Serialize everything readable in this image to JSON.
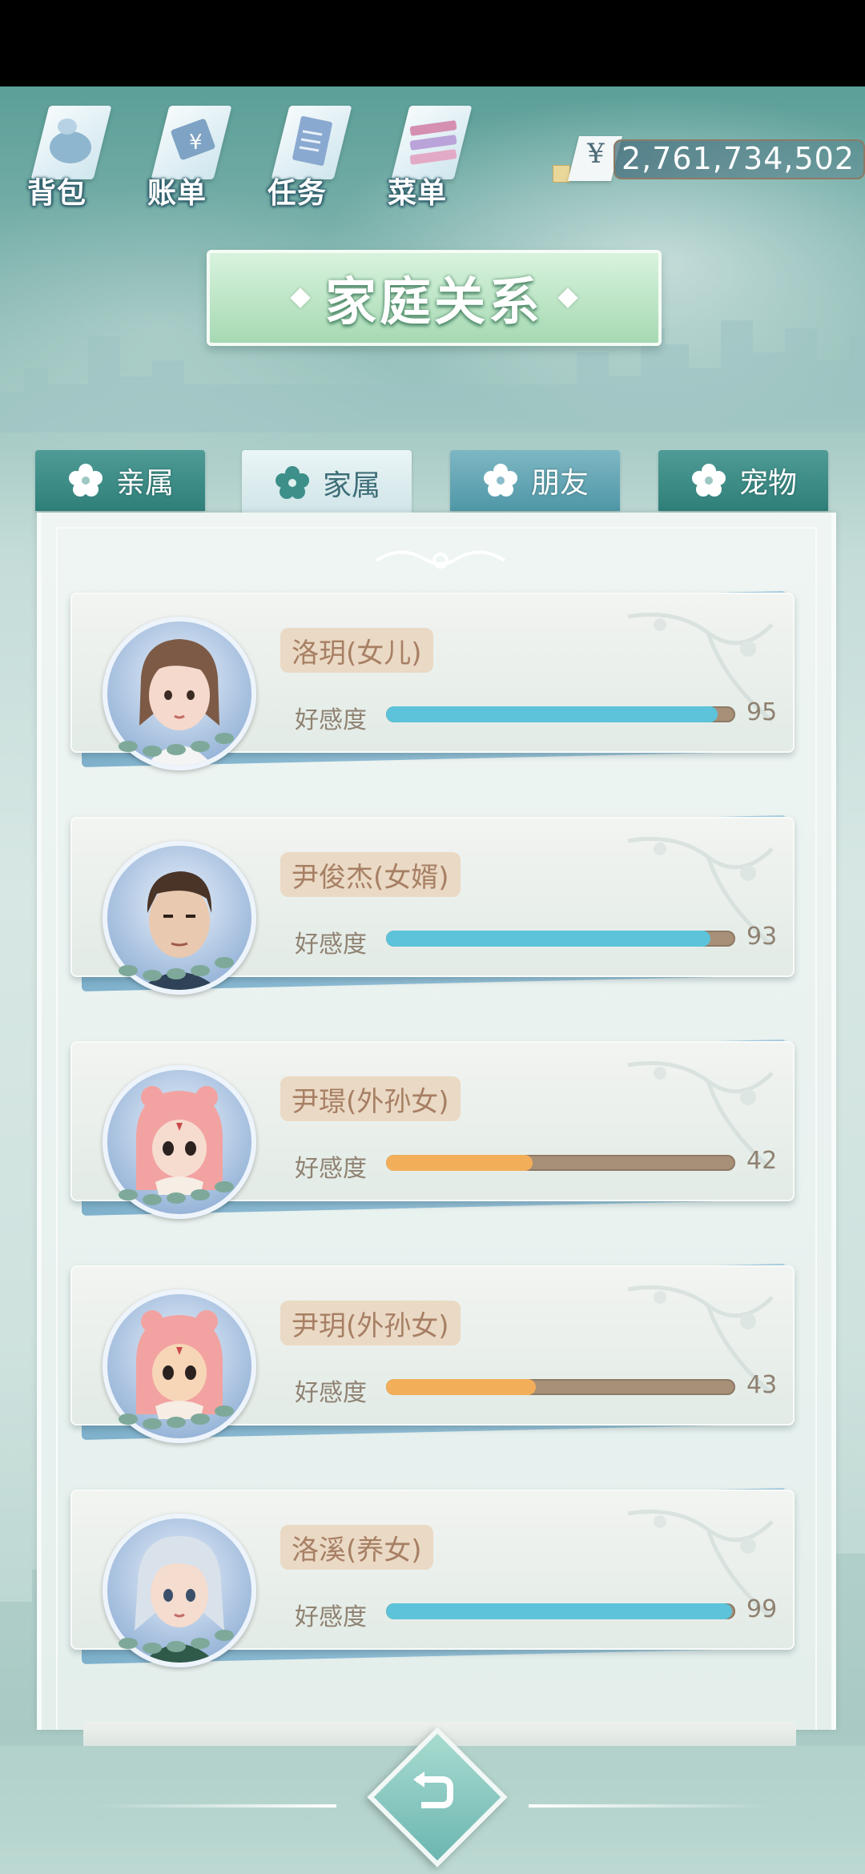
{
  "toolbar": {
    "items": [
      {
        "label": "背包",
        "icon": "backpack-icon"
      },
      {
        "label": "账单",
        "icon": "bill-icon"
      },
      {
        "label": "任务",
        "icon": "task-icon"
      },
      {
        "label": "菜单",
        "icon": "menu-icon"
      }
    ]
  },
  "currency": {
    "symbol": "¥",
    "amount": "2,761,734,502"
  },
  "title": "家庭关系",
  "tabs": [
    {
      "label": "亲属",
      "active": false
    },
    {
      "label": "家属",
      "active": true
    },
    {
      "label": "朋友",
      "active": false
    },
    {
      "label": "宠物",
      "active": false
    }
  ],
  "affinity_label": "好感度",
  "members": [
    {
      "name": "洛玥(女儿)",
      "affinity": 95,
      "bar_color": "blue",
      "avatar": "girl-brown-hair-avatar"
    },
    {
      "name": "尹俊杰(女婿)",
      "affinity": 93,
      "bar_color": "blue",
      "avatar": "man-dark-hair-avatar"
    },
    {
      "name": "尹璟(外孙女)",
      "affinity": 42,
      "bar_color": "orange",
      "avatar": "child-pink-hood-avatar"
    },
    {
      "name": "尹玥(外孙女)",
      "affinity": 43,
      "bar_color": "orange",
      "avatar": "child-pink-hood-avatar"
    },
    {
      "name": "洛溪(养女)",
      "affinity": 99,
      "bar_color": "blue",
      "avatar": "girl-silver-hair-avatar"
    }
  ],
  "colors": {
    "bar_blue": "#5cc3da",
    "bar_orange": "#f3ae5a",
    "bar_track": "#a89078",
    "title_green": "#a6d9b3",
    "tab_dark": "#2f7f79"
  }
}
